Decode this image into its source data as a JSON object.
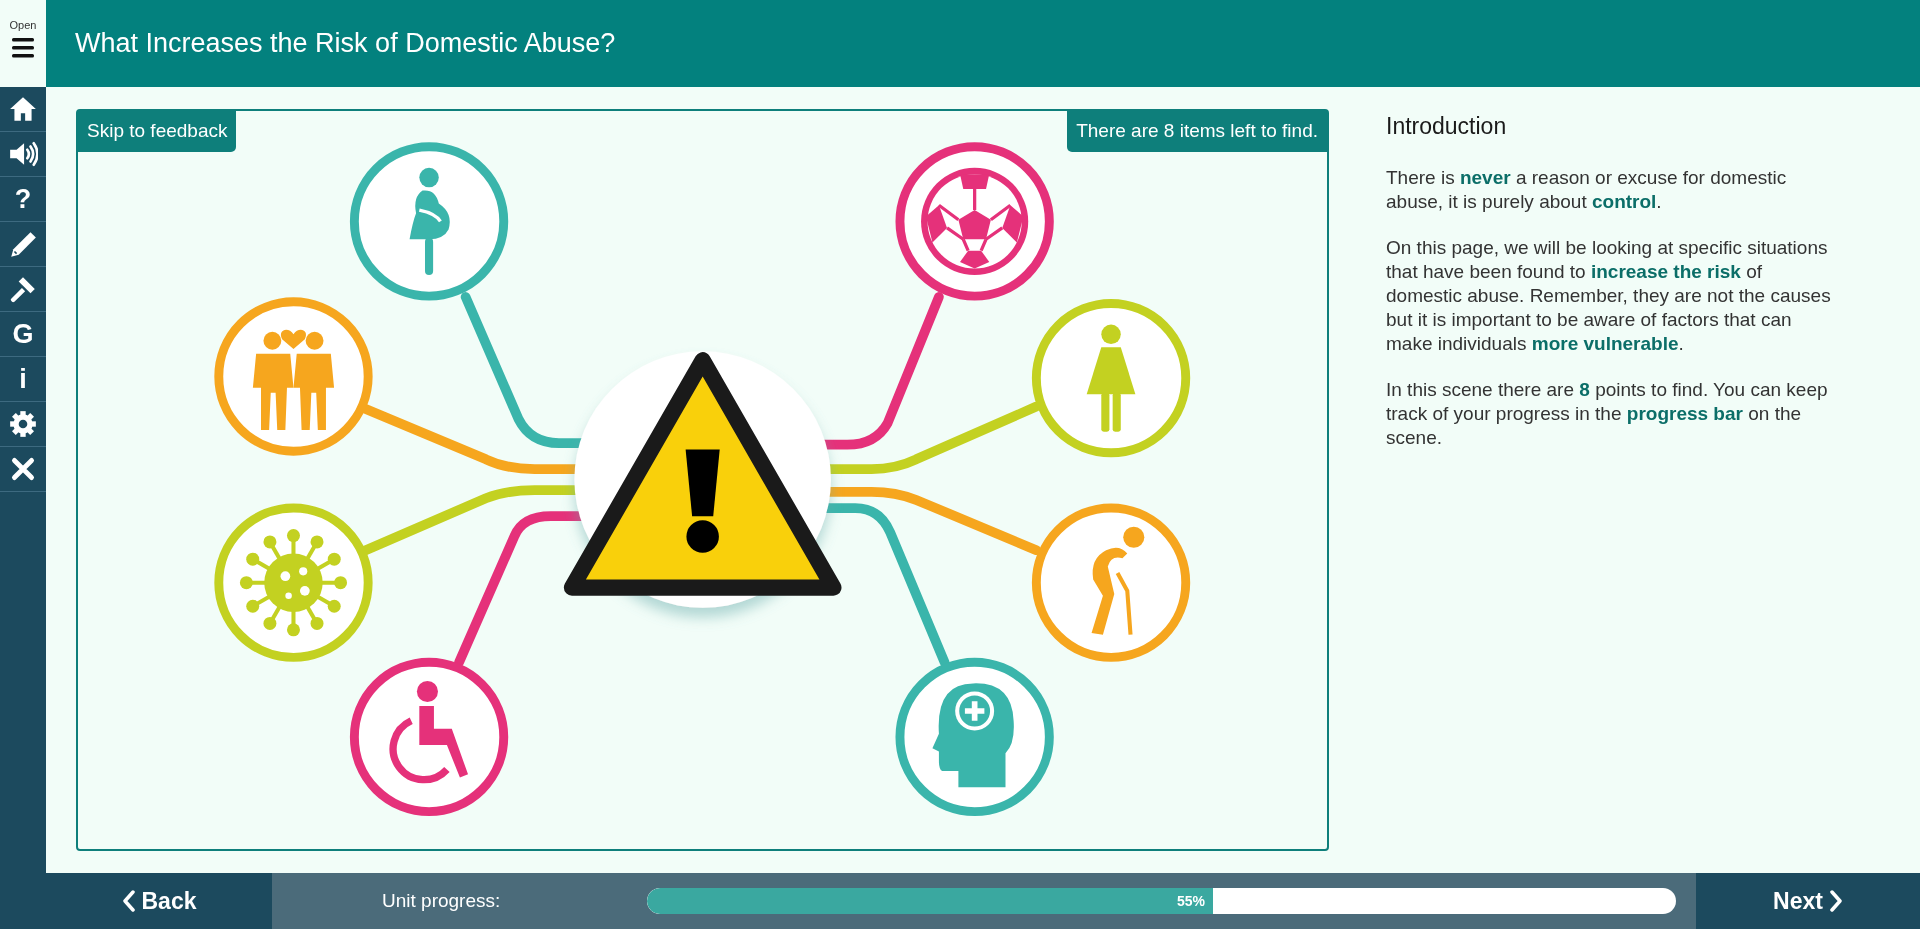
{
  "menu_button": {
    "label": "Open"
  },
  "header": {
    "title": "What Increases the Risk of Domestic Abuse?"
  },
  "sidebar": {
    "items": [
      {
        "kind": "home"
      },
      {
        "kind": "audio"
      },
      {
        "kind": "glyph",
        "label": "?"
      },
      {
        "kind": "pencil"
      },
      {
        "kind": "gavel"
      },
      {
        "kind": "glyph",
        "label": "G"
      },
      {
        "kind": "glyph",
        "label": "i"
      },
      {
        "kind": "settings"
      },
      {
        "kind": "close"
      }
    ]
  },
  "scene": {
    "skip_button": "Skip to feedback",
    "counter": "There are 8 items left to find."
  },
  "introduction": {
    "title": "Introduction",
    "paragraphs": [
      "There is **never** a reason or excuse for domestic abuse, it is purely about **control**.",
      "On this page, we will be looking at specific situations that have been found to **increase the risk** of domestic abuse. Remember, they are not the causes but it is important to be aware of factors that can make individuals **more vulnerable**.",
      "In this scene there are **8** points to find. You can keep track of your progress in the **progress bar** on the scene."
    ]
  },
  "footer": {
    "back_button": "Back",
    "progress_label": "Unit progress:",
    "progress": {
      "level": 0.55,
      "reading": "55%"
    },
    "next_button": "Next"
  }
}
